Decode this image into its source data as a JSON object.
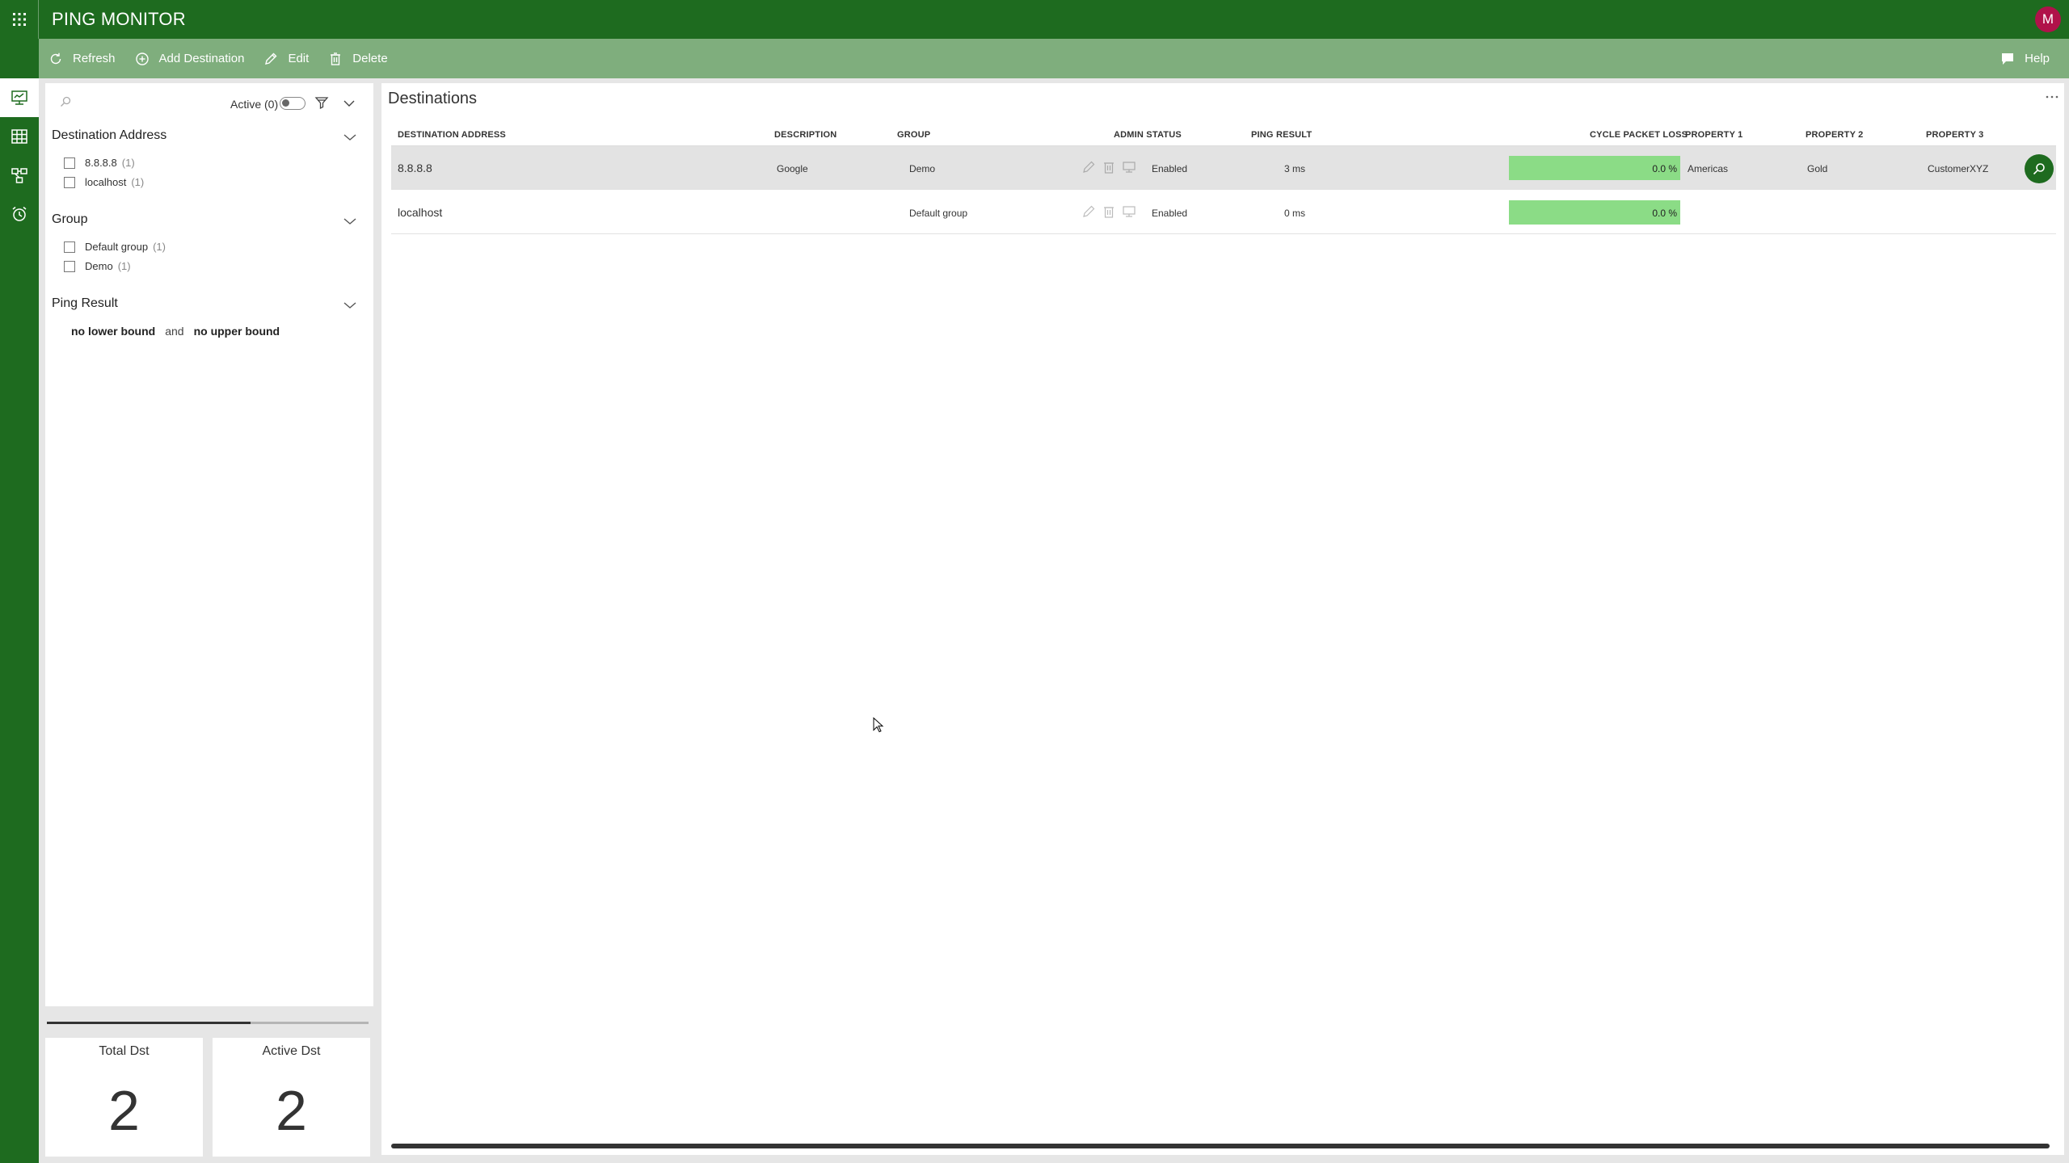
{
  "app": {
    "title": "PING MONITOR",
    "avatar_initial": "M",
    "brand_color": "#1e6b1f",
    "toolbar_color": "#7fae7d"
  },
  "toolbar": {
    "refresh_label": "Refresh",
    "add_label": "Add Destination",
    "edit_label": "Edit",
    "delete_label": "Delete",
    "help_label": "Help"
  },
  "nav": {
    "items": [
      "monitor-icon",
      "grid-icon",
      "topology-icon",
      "alarm-clock-icon"
    ],
    "active_index": 0
  },
  "filters": {
    "active_label": "Active (0)",
    "active_toggle_on": false,
    "sections": [
      {
        "title": "Destination Address",
        "options": [
          {
            "label": "8.8.8.8",
            "count": "(1)",
            "checked": false
          },
          {
            "label": "localhost",
            "count": "(1)",
            "checked": false
          }
        ]
      },
      {
        "title": "Group",
        "options": [
          {
            "label": "Default group",
            "count": "(1)",
            "checked": false
          },
          {
            "label": "Demo",
            "count": "(1)",
            "checked": false
          }
        ]
      },
      {
        "title": "Ping Result",
        "lower": "no lower bound",
        "and": "and",
        "upper": "no upper bound"
      }
    ]
  },
  "stats": {
    "total_label": "Total Dst",
    "total_value": "2",
    "active_label": "Active Dst",
    "active_value": "2"
  },
  "destinations": {
    "title": "Destinations",
    "columns": [
      "DESTINATION ADDRESS",
      "DESCRIPTION",
      "GROUP",
      "ADMIN STATUS",
      "PING RESULT",
      "CYCLE PACKET LOSS",
      "PROPERTY 1",
      "PROPERTY 2",
      "PROPERTY 3"
    ],
    "rows": [
      {
        "address": "8.8.8.8",
        "description": "Google",
        "group": "Demo",
        "admin_status": "Enabled",
        "ping_result": "3 ms",
        "packet_loss": "0.0 %",
        "packet_loss_value": 0.0,
        "property1": "Americas",
        "property2": "Gold",
        "property3": "CustomerXYZ",
        "selected": true
      },
      {
        "address": "localhost",
        "description": "",
        "group": "Default group",
        "admin_status": "Enabled",
        "ping_result": "0 ms",
        "packet_loss": "0.0 %",
        "packet_loss_value": 0.0,
        "property1": "",
        "property2": "",
        "property3": "",
        "selected": false
      }
    ],
    "loss_bar_color": "#8bdc86"
  }
}
